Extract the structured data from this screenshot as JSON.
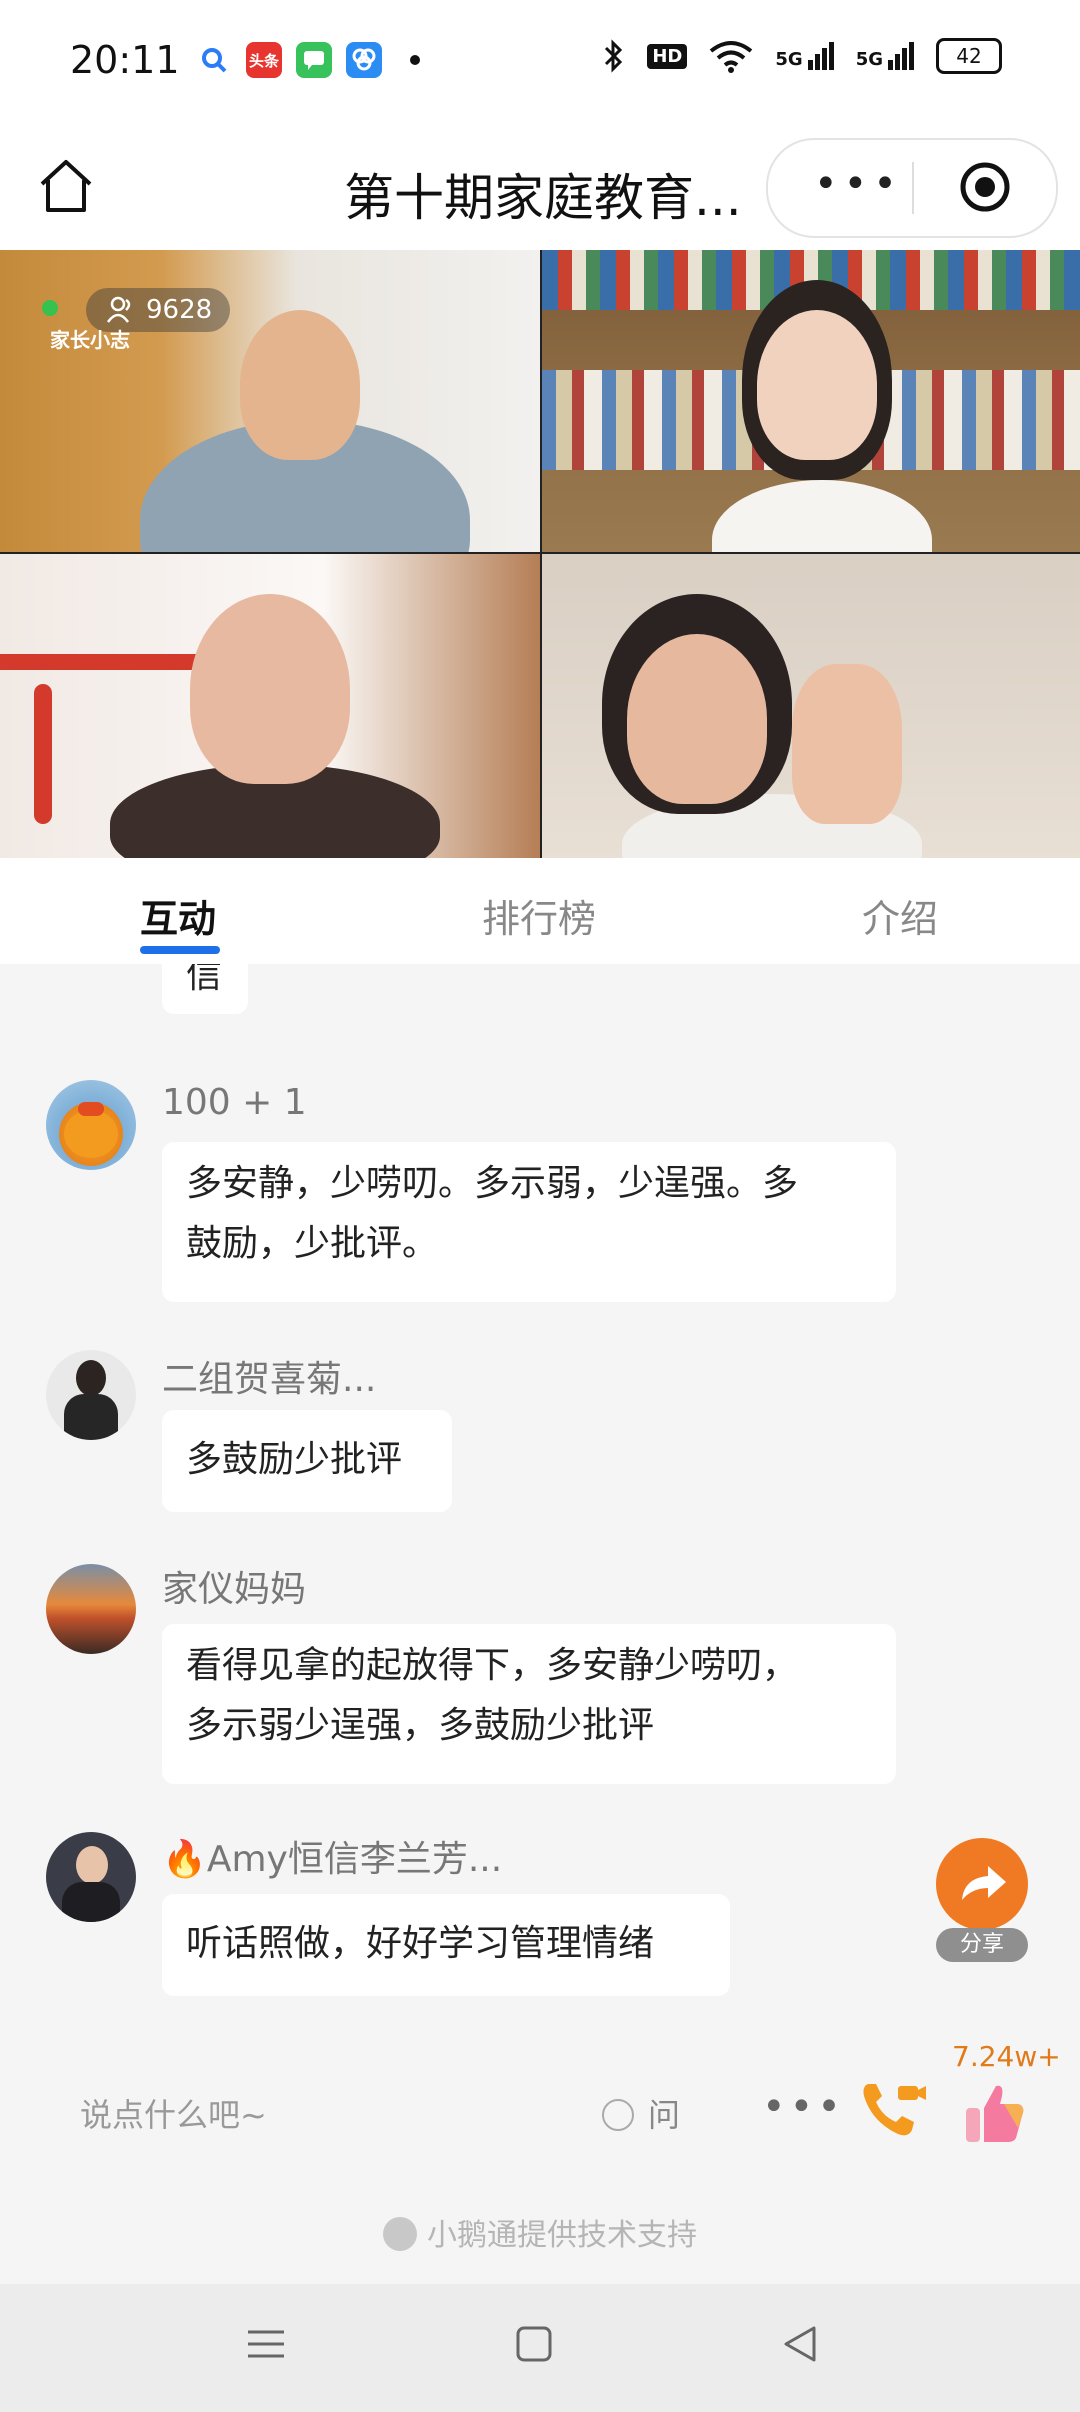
{
  "status_bar": {
    "time": "20:11",
    "app_icons": [
      "search-app-icon",
      "toutiao-icon",
      "messages-icon",
      "browser-icon"
    ],
    "toutiao_text": "头条",
    "right_icons": [
      "bluetooth-icon",
      "hd-icon",
      "wifi-icon",
      "signal-5g-icon",
      "signal-5g-icon-2"
    ],
    "hd_text": "HD",
    "sig1": "5G",
    "sig2": "5G",
    "battery": "42"
  },
  "title_bar": {
    "title": "第十期家庭教育..."
  },
  "live": {
    "viewer_count": "9628",
    "brand": "家长小志"
  },
  "tabs": [
    {
      "label": "互动"
    },
    {
      "label": "排行榜"
    },
    {
      "label": "介绍"
    }
  ],
  "chat": {
    "partial_message": "信",
    "messages": [
      {
        "user": "100 + 1",
        "text_line1": "多安静，少唠叨。多示弱，少逞强。多",
        "text_line2": "鼓励，少批评。"
      },
      {
        "user": "二组贺喜菊...",
        "text_line1": "多鼓励少批评"
      },
      {
        "user": "家仪妈妈",
        "text_line1": "看得见拿的起放得下，多安静少唠叨，",
        "text_line2": "多示弱少逞强，多鼓励少批评"
      },
      {
        "user": "Amy恒信李兰芳...",
        "user_prefix": "🔥",
        "text_line1": "听话照做，好好学习管理情绪"
      }
    ]
  },
  "share": {
    "label": "分享"
  },
  "input_bar": {
    "placeholder": "说点什么吧~",
    "ask_label": "问",
    "like_count": "7.24w+"
  },
  "support_text": "小鹅通提供技术支持",
  "colors": {
    "accent": "#1f6fe8",
    "share": "#f07a24",
    "like": "#e07a1a"
  }
}
